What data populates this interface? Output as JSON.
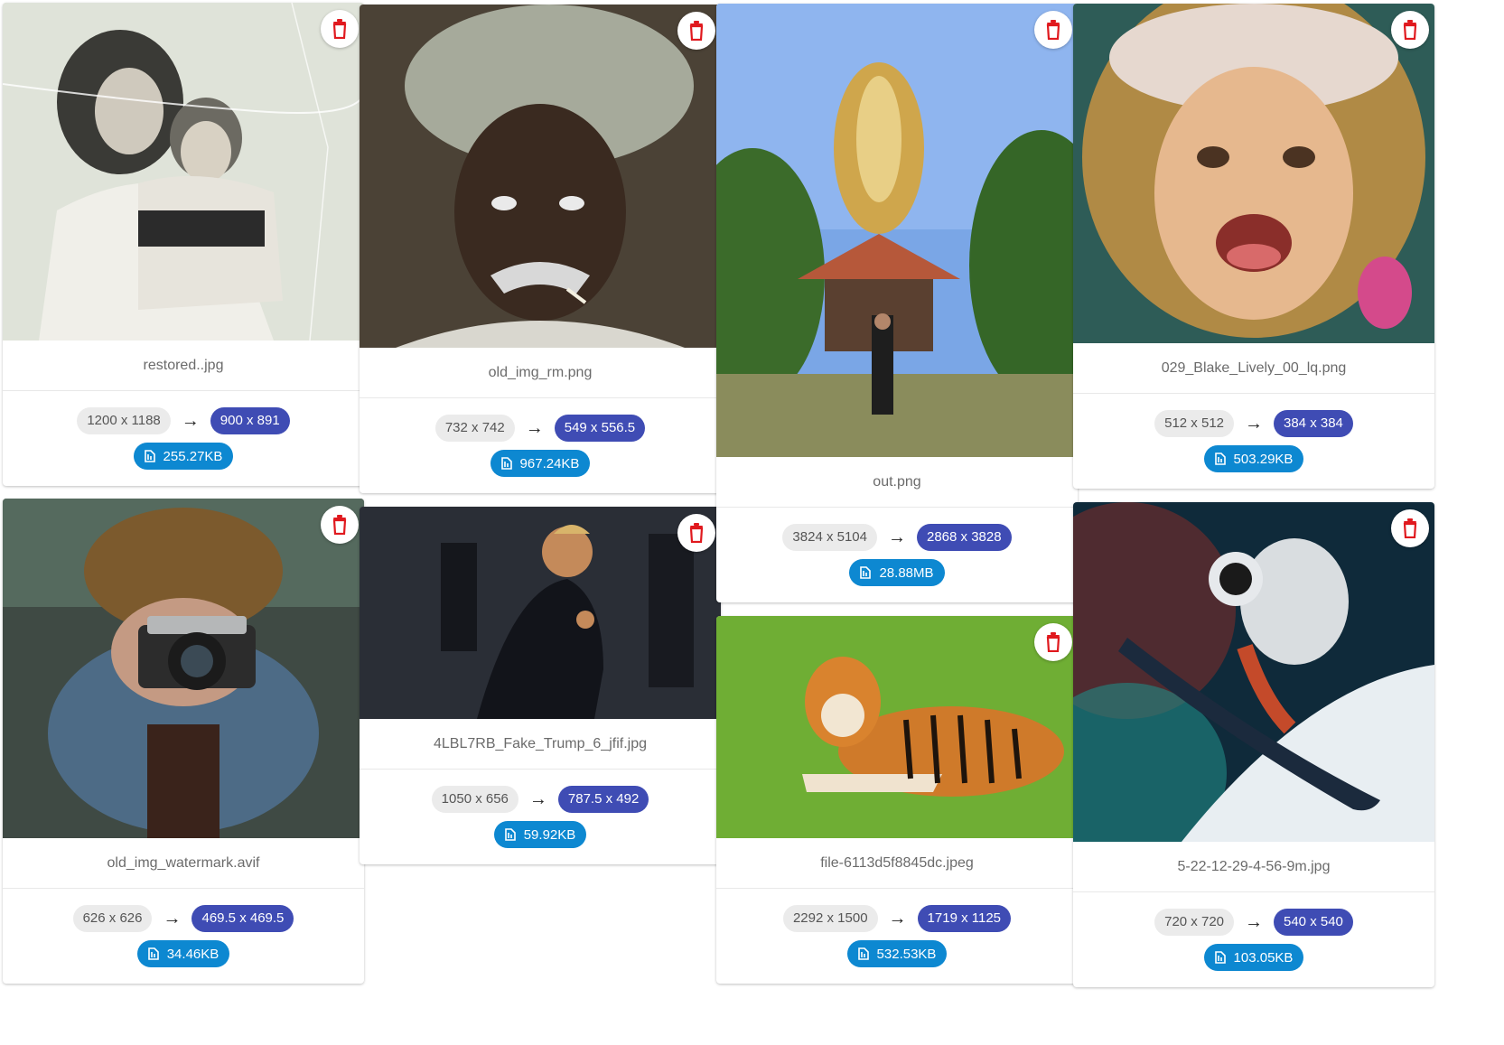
{
  "cards": [
    {
      "filename": "restored..jpg",
      "orig": "1200 x 1188",
      "scaled": "900 x 891",
      "size": "255.27KB"
    },
    {
      "filename": "old_img_watermark.avif",
      "orig": "626 x 626",
      "scaled": "469.5 x 469.5",
      "size": "34.46KB"
    },
    {
      "filename": "old_img_rm.png",
      "orig": "732 x 742",
      "scaled": "549 x 556.5",
      "size": "967.24KB"
    },
    {
      "filename": "4LBL7RB_Fake_Trump_6_jfif.jpg",
      "orig": "1050 x 656",
      "scaled": "787.5 x 492",
      "size": "59.92KB"
    },
    {
      "filename": "out.png",
      "orig": "3824 x 5104",
      "scaled": "2868 x 3828",
      "size": "28.88MB"
    },
    {
      "filename": "file-6113d5f8845dc.jpeg",
      "orig": "2292 x 1500",
      "scaled": "1719 x 1125",
      "size": "532.53KB"
    },
    {
      "filename": "029_Blake_Lively_00_lq.png",
      "orig": "512 x 512",
      "scaled": "384 x 384",
      "size": "503.29KB"
    },
    {
      "filename": "5-22-12-29-4-56-9m.jpg",
      "orig": "720 x 720",
      "scaled": "540 x 540",
      "size": "103.05KB"
    }
  ],
  "arrow": "→",
  "colors": {
    "delete_icon": "#e0191e",
    "scaled_chip": "#3f4cb4",
    "size_chip": "#0d88d1",
    "orig_chip": "#ebebeb"
  },
  "icons": {
    "delete": "trash-icon",
    "file_size": "file-size-icon"
  }
}
